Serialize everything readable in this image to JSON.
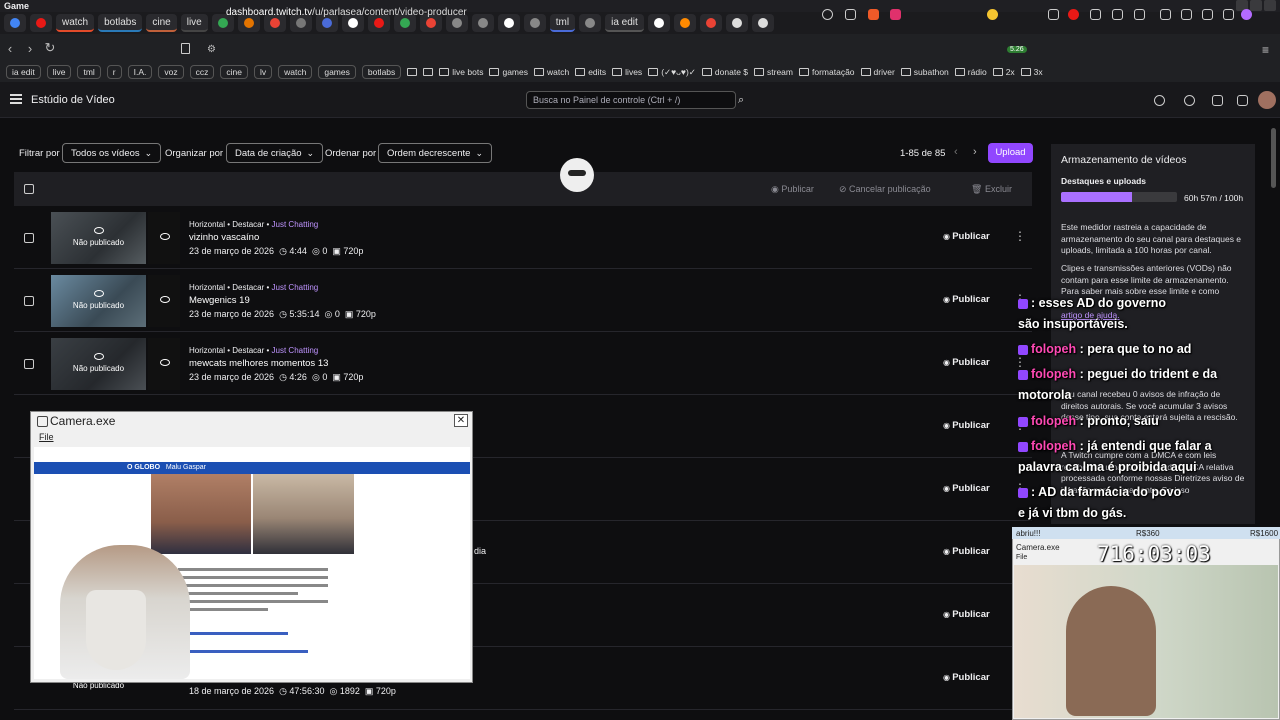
{
  "window": {
    "title": "Game"
  },
  "tabs": [
    {
      "label": "",
      "color": "#4285f4"
    },
    {
      "label": "",
      "color": "#e91916"
    },
    {
      "label": "watch",
      "color": "#e34b2a"
    },
    {
      "label": "botlabs",
      "color": "#2a7ab8"
    },
    {
      "label": "cine",
      "color": "#c0603a"
    },
    {
      "label": "live",
      "color": "#444"
    },
    {
      "label": "",
      "color": "#34a853"
    },
    {
      "label": "",
      "color": "#e37400"
    },
    {
      "label": "",
      "color": "#ea4335"
    },
    {
      "label": "",
      "color": "#777"
    },
    {
      "label": "",
      "color": "#4a6bd8"
    },
    {
      "label": "",
      "color": "#ffffff"
    },
    {
      "label": "",
      "color": "#e91916"
    },
    {
      "label": "",
      "color": "#34a853"
    },
    {
      "label": "",
      "color": "#ea4335"
    },
    {
      "label": "",
      "color": "#888"
    },
    {
      "label": "",
      "color": "#888"
    },
    {
      "label": "",
      "color": "#ffffff"
    },
    {
      "label": "",
      "color": "#888"
    },
    {
      "label": "tml",
      "color": "#4a6bd8"
    },
    {
      "label": "",
      "color": "#888"
    },
    {
      "label": "ia edit",
      "color": "#555"
    },
    {
      "label": "",
      "color": "#ffffff"
    },
    {
      "label": "",
      "color": "#ff8a00"
    },
    {
      "label": "",
      "color": "#ea4335"
    },
    {
      "label": "",
      "color": "#ddd"
    },
    {
      "label": "",
      "color": "#ddd"
    }
  ],
  "address": {
    "url_host": "dashboard.twitch.tv",
    "url_path": "/u/parlasea/content/video-producer",
    "badge": "5.26"
  },
  "bookmarks": [
    {
      "label": "ia edit",
      "pill": true
    },
    {
      "label": "live",
      "pill": true
    },
    {
      "label": "tml",
      "pill": true
    },
    {
      "label": "r",
      "pill": true
    },
    {
      "label": "I.A.",
      "pill": true
    },
    {
      "label": "voz",
      "pill": true
    },
    {
      "label": "ccz",
      "pill": true
    },
    {
      "label": "cine",
      "pill": true
    },
    {
      "label": "lv",
      "pill": true
    },
    {
      "label": "watch",
      "pill": true
    },
    {
      "label": "games",
      "pill": true
    },
    {
      "label": "botlabs",
      "pill": true
    },
    {
      "label": "",
      "pill": false
    },
    {
      "label": "",
      "pill": false
    },
    {
      "label": "live bots",
      "pill": false
    },
    {
      "label": "games",
      "pill": false
    },
    {
      "label": "watch",
      "pill": false
    },
    {
      "label": "edits",
      "pill": false
    },
    {
      "label": "lives",
      "pill": false
    },
    {
      "label": "(✓♥ᴗ♥)✓",
      "pill": false
    },
    {
      "label": "donate $",
      "pill": false
    },
    {
      "label": "stream",
      "pill": false
    },
    {
      "label": "formatação",
      "pill": false
    },
    {
      "label": "driver",
      "pill": false
    },
    {
      "label": "subathon",
      "pill": false
    },
    {
      "label": "rádio",
      "pill": false
    },
    {
      "label": "2x",
      "pill": false
    },
    {
      "label": "3x",
      "pill": false
    }
  ],
  "header": {
    "studio_title": "Estúdio de Vídeo",
    "search_placeholder": "Busca no Painel de controle (Ctrl + /)"
  },
  "filters": {
    "filter_label": "Filtrar por",
    "filter_value": "Todos os vídeos",
    "organize_label": "Organizar por",
    "organize_value": "Data de criação",
    "order_label": "Ordenar por",
    "order_value": "Ordem decrescente",
    "pager": "1-85 de 85",
    "upload_label": "Upload"
  },
  "table_actions": {
    "publish": "Publicar",
    "unpublish": "Cancelar publicação",
    "delete": "Excluir"
  },
  "videos": [
    {
      "meta": "Horizontal • Destacar •",
      "category": "Just Chatting",
      "title": "vizinho vascaíno",
      "date": "23 de março de 2026",
      "duration": "4:44",
      "views": "0",
      "quality": "720p",
      "thumb_text": "Não publicado",
      "action": "Publicar"
    },
    {
      "meta": "Horizontal • Destacar •",
      "category": "Just Chatting",
      "title": "Mewgenics 19",
      "date": "23 de março de 2026",
      "duration": "5:35:14",
      "views": "0",
      "quality": "720p",
      "thumb_text": "Não publicado",
      "action": "Publicar"
    },
    {
      "meta": "Horizontal • Destacar •",
      "category": "Just Chatting",
      "title": "mewcats melhores momentos 13",
      "date": "23 de março de 2026",
      "duration": "4:26",
      "views": "0",
      "quality": "720p",
      "thumb_text": "Não publicado",
      "action": "Publicar"
    }
  ],
  "hidden_rows": [
    {
      "action": "Publicar"
    },
    {
      "action": "Publicar"
    },
    {
      "action": "Publicar",
      "fragment": "dia"
    },
    {
      "action": "Publicar"
    }
  ],
  "last_row": {
    "thumb_text": "Não publicado",
    "date": "18 de março de 2026",
    "duration": "47:56:30",
    "views": "1892",
    "quality": "720p",
    "action": "Publicar"
  },
  "storage": {
    "title": "Armazenamento de vídeos",
    "subtitle": "Destaques e uploads",
    "usage": "60h 57m / 100h",
    "usage_fraction": 0.61,
    "p1": "Este medidor rastreia a capacidade de armazenamento do seu canal para destaques e uploads, limitada a 100 horas por canal.",
    "p2": "Clipes e transmissões anteriores (VODs) não contam para esse limite de armazenamento. Para saber mais sobre esse limite e como",
    "p3": "artigo de ajuda.",
    "p4": "seu canal recebeu 0 avisos de infração de direitos autorais. Se você acumular 3 avisos desse tipo, sua conta estará sujeita a rescisão.",
    "p5": "A Twitch cumpre com a DMCA e com leis recebemos uma notificação de DMCA relativa processada conforme nossas Diretrizes aviso de infração para a sua conta. Se isso"
  },
  "chat": [
    {
      "name": "",
      "message": ": esses AD do governo"
    },
    {
      "name": "",
      "message": "são insuportáveis."
    },
    {
      "name": "folopeh",
      "message": ": pera que to no ad"
    },
    {
      "name": "folopeh",
      "message": ": peguei do trident e da"
    },
    {
      "name": "",
      "message": "motorola"
    },
    {
      "name": "folopeh",
      "message": ": pronto, saiu"
    },
    {
      "name": "folopeh",
      "message": ": já entendi que falar a"
    },
    {
      "name": "",
      "message": "palavra ca.lma é proibida aqui"
    },
    {
      "name": "",
      "message": ": AD da farmácia do povo"
    },
    {
      "name": "",
      "message": "e já vi tbm do gás."
    }
  ],
  "timer": {
    "left_label": "abriu!!!",
    "mid_label": "R$360",
    "right_label": "R$1600",
    "clock": "716:03:03",
    "camera_title": "Camera.exe",
    "file_label": "File"
  },
  "camera_window": {
    "title": "Camera.exe",
    "menu": "File",
    "close": "✕",
    "article_logo": "O GLOBO",
    "article_site": "Malu Gaspar"
  }
}
